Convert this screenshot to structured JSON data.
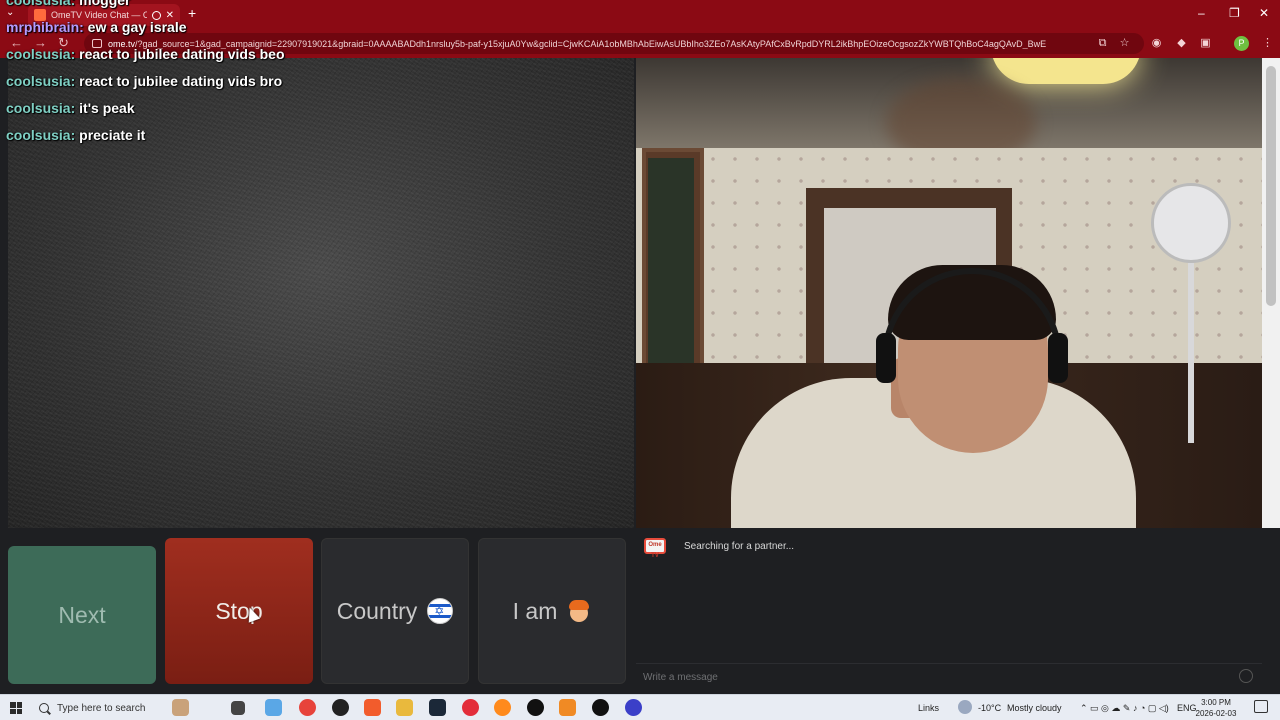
{
  "browser": {
    "tab_title": "OmeTV Video Chat — Ome",
    "url_domain": "ome.tv",
    "url_rest": "/?gad_source=1&gad_campaignid=22907919021&gbraid=0AAAABADdh1nrsluy5b-paf-y15xjuA0Yw&gclid=CjwKCAiA1obMBhAbEiwAsUBbIho3ZEo7AsKAtyPAfCxBvRpdDYRL2ikBhpEOizeOcgsozZkYWBTQhBoC4agQAvD_BwE"
  },
  "chat_overlay": [
    {
      "user": "coolsusia:",
      "message": "mogger",
      "color": "#7fd0c4"
    },
    {
      "user": "mrphibrain:",
      "message": "ew a gay israle",
      "color": "#b59cff"
    },
    {
      "user": "coolsusia:",
      "message": "react to jubilee dating vids beo",
      "color": "#7fd0c4"
    },
    {
      "user": "coolsusia:",
      "message": "react to jubilee dating vids bro",
      "color": "#7fd0c4"
    },
    {
      "user": "coolsusia:",
      "message": "it's peak",
      "color": "#7fd0c4"
    },
    {
      "user": "coolsusia:",
      "message": "preciate it",
      "color": "#7fd0c4"
    }
  ],
  "controls": {
    "next_label": "Next",
    "stop_label": "Stop",
    "country_label": "Country",
    "country_flag": "israel-flag-icon",
    "iam_label": "I am",
    "iam_avatar": "boy-avatar-icon"
  },
  "chat": {
    "status": "Searching for a partner...",
    "status_logo": "Ome TV",
    "input_placeholder": "Write a message"
  },
  "taskbar": {
    "search_placeholder": "Type here to search",
    "links_label": "Links",
    "weather_temp": "-10°C",
    "weather_desc": "Mostly cloudy",
    "language": "ENG",
    "time": "3:00 PM",
    "date": "2026-02-03"
  },
  "colors": {
    "browser_chrome": "#8b0a14",
    "next_button": "#3d6b58",
    "stop_button": "#a02e1f"
  }
}
